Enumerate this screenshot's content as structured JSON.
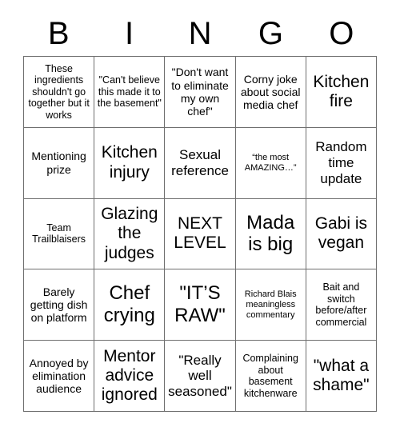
{
  "header": {
    "letters": [
      "B",
      "I",
      "N",
      "G",
      "O"
    ]
  },
  "grid": {
    "rows": [
      [
        {
          "text": "These ingredients shouldn't go together but it works",
          "size": "fs-s"
        },
        {
          "text": "\"Can't believe this made it to the basement\"",
          "size": "fs-s"
        },
        {
          "text": "\"Don't want to eliminate my own chef\"",
          "size": "fs-m"
        },
        {
          "text": "Corny joke about social media chef",
          "size": "fs-m"
        },
        {
          "text": "Kitchen fire",
          "size": "fs-xl"
        }
      ],
      [
        {
          "text": "Mentioning prize",
          "size": "fs-m"
        },
        {
          "text": "Kitchen injury",
          "size": "fs-xl"
        },
        {
          "text": "Sexual reference",
          "size": "fs-l"
        },
        {
          "text": "“the most AMAZING…”",
          "size": "fs-xs"
        },
        {
          "text": "Random time update",
          "size": "fs-l"
        }
      ],
      [
        {
          "text": "Team Trailblaisers",
          "size": "fs-s"
        },
        {
          "text": "Glazing the judges",
          "size": "fs-xl"
        },
        {
          "text": "NEXT LEVEL",
          "size": "fs-xl"
        },
        {
          "text": "Mada is big",
          "size": "fs-xxl"
        },
        {
          "text": "Gabi is vegan",
          "size": "fs-xl"
        }
      ],
      [
        {
          "text": "Barely getting dish on platform",
          "size": "fs-m"
        },
        {
          "text": "Chef crying",
          "size": "fs-xxl"
        },
        {
          "text": "\"IT’S RAW\"",
          "size": "fs-xxl"
        },
        {
          "text": "Richard Blais meaningless commentary",
          "size": "fs-xs"
        },
        {
          "text": "Bait and switch before/after commercial",
          "size": "fs-s"
        }
      ],
      [
        {
          "text": "Annoyed by elimination audience",
          "size": "fs-m"
        },
        {
          "text": "Mentor advice ignored",
          "size": "fs-xl"
        },
        {
          "text": "\"Really well seasoned\"",
          "size": "fs-l"
        },
        {
          "text": "Complaining about basement kitchenware",
          "size": "fs-s"
        },
        {
          "text": "\"what a shame\"",
          "size": "fs-xl"
        }
      ]
    ]
  }
}
